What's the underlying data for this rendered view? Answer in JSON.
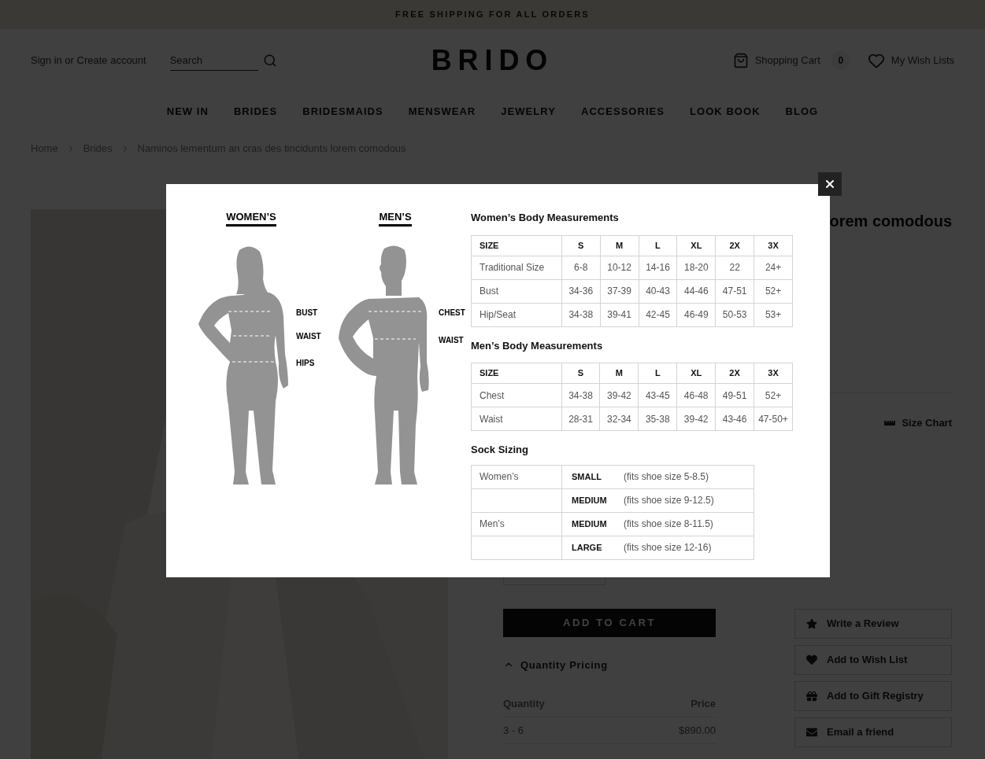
{
  "announcement": "FREE SHIPPING FOR ALL ORDERS",
  "header": {
    "account_link": "Sign in or Create account",
    "search": {
      "placeholder": "Search"
    },
    "logo": "BRIDO",
    "cart": {
      "label": "Shopping Cart",
      "count": "0"
    },
    "wishlist": "My Wish Lists"
  },
  "nav": [
    "NEW IN",
    "BRIDES",
    "BRIDESMAIDS",
    "MENSWEAR",
    "JEWELRY",
    "ACCESSORIES",
    "LOOK BOOK",
    "BLOG"
  ],
  "breadcrumb": [
    "Home",
    "Brides",
    "Naminos lementum an cras des tincidunts lorem comodous"
  ],
  "product": {
    "title": "orem comodous",
    "size_chart_link": "Size Chart",
    "add_to_cart": "ADD TO CART",
    "quantity_pricing": {
      "title": "Quantity Pricing",
      "expanded": true,
      "columns": [
        "Quantity",
        "Price"
      ],
      "rows": [
        [
          "3 - 6",
          "$890.00"
        ]
      ]
    },
    "actions": [
      {
        "kind": "review",
        "label": "Write a Review"
      },
      {
        "kind": "wishlist",
        "label": "Add to Wish List"
      },
      {
        "kind": "gift",
        "label": "Add to Gift Registry"
      },
      {
        "kind": "email",
        "label": "Email a friend"
      }
    ]
  },
  "size_modal": {
    "figures": [
      {
        "kind": "woman",
        "title": "WOMEN’S",
        "labels": [
          "BUST",
          "WAIST",
          "HIPS"
        ]
      },
      {
        "kind": "man",
        "title": "MEN’S",
        "labels": [
          "CHEST",
          "WAIST"
        ]
      }
    ],
    "tables": [
      {
        "title": "Women’s Body Measurements",
        "columns": [
          "SIZE",
          "S",
          "M",
          "L",
          "XL",
          "2X",
          "3X"
        ],
        "rows": [
          [
            "Traditional Size",
            "6-8",
            "10-12",
            "14-16",
            "18-20",
            "22",
            "24+"
          ],
          [
            "Bust",
            "34-36",
            "37-39",
            "40-43",
            "44-46",
            "47-51",
            "52+"
          ],
          [
            "Hip/Seat",
            "34-38",
            "39-41",
            "42-45",
            "46-49",
            "50-53",
            "53+"
          ]
        ]
      },
      {
        "title": "Men’s Body Measurements",
        "columns": [
          "SIZE",
          "S",
          "M",
          "L",
          "XL",
          "2X",
          "3X"
        ],
        "rows": [
          [
            "Chest",
            "34-38",
            "39-42",
            "43-45",
            "46-48",
            "49-51",
            "52+"
          ],
          [
            "Waist",
            "28-31",
            "32-34",
            "35-38",
            "39-42",
            "43-46",
            "47-50+"
          ]
        ]
      }
    ],
    "sock_sizing": {
      "title": "Sock Sizing",
      "rows": [
        {
          "group": "Women’s",
          "size": "SMALL",
          "note": "(fits shoe size 5-8.5)"
        },
        {
          "size": "MEDIUM",
          "note": "(fits shoe size 9-12.5)"
        },
        {
          "group": "Men’s",
          "size": "MEDIUM",
          "note": "(fits shoe size 8-11.5)"
        },
        {
          "size": "LARGE",
          "note": "(fits shoe size 12-16)"
        }
      ]
    }
  }
}
